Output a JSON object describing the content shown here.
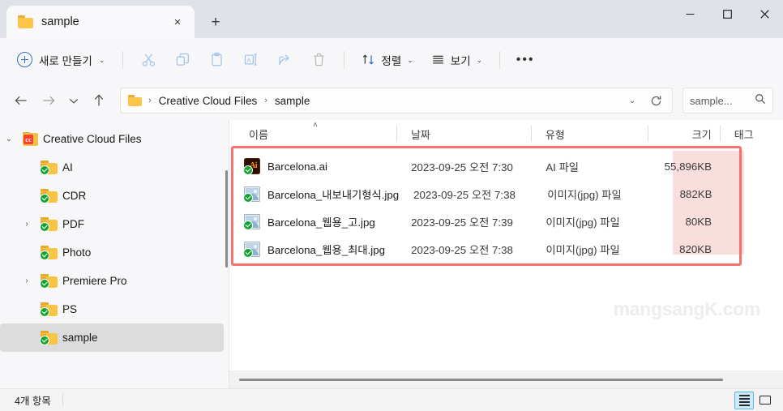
{
  "titlebar": {
    "tab_label": "sample",
    "tab_close": "×",
    "newtab_label": "+",
    "minimize": "─",
    "maximize": "□",
    "close": "✕",
    "folder_icon": "folder-icon"
  },
  "toolbar": {
    "new_label": "새로 만들기",
    "new_chevron": "⌄",
    "cut_icon": "scissors-icon",
    "copy_icon": "copy-icon",
    "paste_icon": "paste-icon",
    "rename_icon": "rename-icon",
    "share_icon": "share-icon",
    "delete_icon": "trash-icon",
    "sort_label": "정렬",
    "sort_chevron": "⌄",
    "view_label": "보기",
    "view_chevron": "⌄",
    "more_label": "•••"
  },
  "address": {
    "back": "←",
    "forward": "→",
    "recent": "⌄",
    "up": "↑",
    "crumbs": [
      "Creative Cloud Files",
      "sample"
    ],
    "separator": "›",
    "dropdown_chevron": "⌄",
    "refresh_icon": "refresh-icon"
  },
  "search": {
    "value": "sample...",
    "icon": "search-icon"
  },
  "sidebar": {
    "root": {
      "label": "Creative Cloud Files",
      "expander": "⌄",
      "icon": "creative-cloud-folder-icon",
      "badge_letters": "cc"
    },
    "items": [
      {
        "label": "AI",
        "expander": "",
        "selected": false
      },
      {
        "label": "CDR",
        "expander": "",
        "selected": false
      },
      {
        "label": "PDF",
        "expander": "›",
        "selected": false
      },
      {
        "label": "Photo",
        "expander": "",
        "selected": false
      },
      {
        "label": "Premiere Pro",
        "expander": "›",
        "selected": false
      },
      {
        "label": "PS",
        "expander": "",
        "selected": false
      },
      {
        "label": "sample",
        "expander": "",
        "selected": true
      }
    ]
  },
  "filelist": {
    "columns": {
      "name": "이름",
      "date": "날짜",
      "type": "유형",
      "size": "크기",
      "tag": "태그"
    },
    "sort_indicator": "˄",
    "rows": [
      {
        "name": "Barcelona.ai",
        "date": "2023-09-25 오전 7:30",
        "type": "AI 파일",
        "size": "55,896KB",
        "tag": "",
        "icon": "illustrator-file-icon",
        "icon_letters": "Ai"
      },
      {
        "name": "Barcelona_내보내기형식.jpg",
        "date": "2023-09-25 오전 7:38",
        "type": "이미지(jpg) 파일",
        "size": "882KB",
        "tag": "",
        "icon": "image-file-icon",
        "icon_letters": ""
      },
      {
        "name": "Barcelona_웹용_고.jpg",
        "date": "2023-09-25 오전 7:39",
        "type": "이미지(jpg) 파일",
        "size": "80KB",
        "tag": "",
        "icon": "image-file-icon",
        "icon_letters": ""
      },
      {
        "name": "Barcelona_웹용_최대.jpg",
        "date": "2023-09-25 오전 7:38",
        "type": "이미지(jpg) 파일",
        "size": "820KB",
        "tag": "",
        "icon": "image-file-icon",
        "icon_letters": ""
      }
    ]
  },
  "watermark": "mangsangK.com",
  "statusbar": {
    "item_count": "4개 항목",
    "details_view_icon": "details-view-icon",
    "large_icons_view_icon": "large-icons-view-icon"
  },
  "colors": {
    "highlight_border": "#f4736f",
    "highlight_fill": "#fadedd",
    "accent": "#2f6fd0",
    "sync_green": "#14a333",
    "selection": "#dcdcdc"
  }
}
